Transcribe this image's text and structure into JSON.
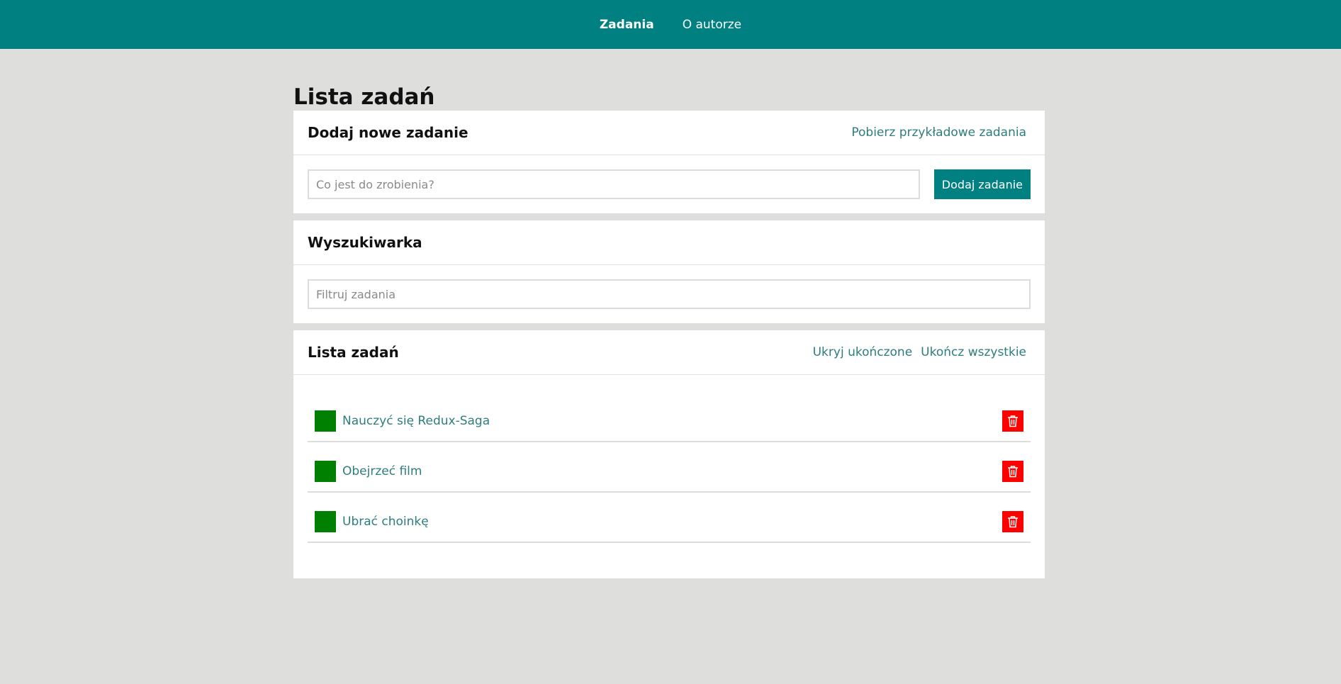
{
  "nav": {
    "tasks_label": "Zadania",
    "author_label": "O autorze"
  },
  "page_title": "Lista zadań",
  "add_section": {
    "title": "Dodaj nowe zadanie",
    "fetch_examples_label": "Pobierz przykładowe zadania",
    "input_placeholder": "Co jest do zrobienia?",
    "input_value": "",
    "submit_label": "Dodaj zadanie"
  },
  "search_section": {
    "title": "Wyszukiwarka",
    "input_placeholder": "Filtruj zadania",
    "input_value": ""
  },
  "list_section": {
    "title": "Lista zadań",
    "hide_done_label": "Ukryj ukończone",
    "complete_all_label": "Ukończ wszystkie",
    "tasks": [
      {
        "content": "Nauczyć się Redux-Saga"
      },
      {
        "content": "Obejrzeć film"
      },
      {
        "content": "Ubrać choinkę"
      }
    ]
  },
  "colors": {
    "nav_background": "#008080",
    "page_background": "#dededc",
    "accent_text": "#2e7d7d",
    "toggle_done": "#008000",
    "remove_button": "#ff0000"
  },
  "icons": {
    "remove": "trash-icon"
  }
}
